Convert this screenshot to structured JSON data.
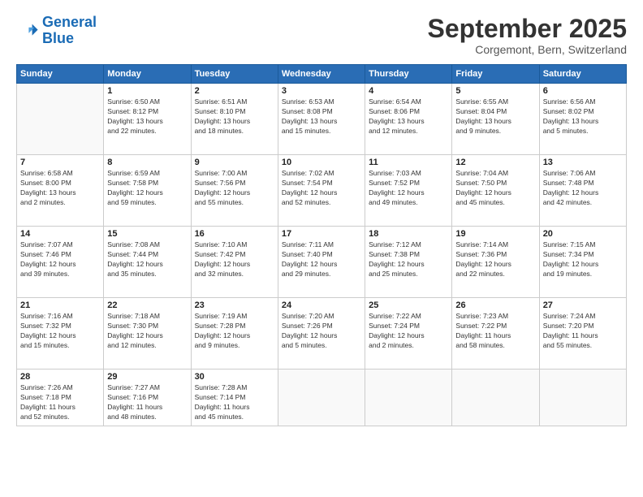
{
  "logo": {
    "line1": "General",
    "line2": "Blue"
  },
  "title": "September 2025",
  "subtitle": "Corgemont, Bern, Switzerland",
  "headers": [
    "Sunday",
    "Monday",
    "Tuesday",
    "Wednesday",
    "Thursday",
    "Friday",
    "Saturday"
  ],
  "weeks": [
    [
      {
        "day": "",
        "info": ""
      },
      {
        "day": "1",
        "info": "Sunrise: 6:50 AM\nSunset: 8:12 PM\nDaylight: 13 hours\nand 22 minutes."
      },
      {
        "day": "2",
        "info": "Sunrise: 6:51 AM\nSunset: 8:10 PM\nDaylight: 13 hours\nand 18 minutes."
      },
      {
        "day": "3",
        "info": "Sunrise: 6:53 AM\nSunset: 8:08 PM\nDaylight: 13 hours\nand 15 minutes."
      },
      {
        "day": "4",
        "info": "Sunrise: 6:54 AM\nSunset: 8:06 PM\nDaylight: 13 hours\nand 12 minutes."
      },
      {
        "day": "5",
        "info": "Sunrise: 6:55 AM\nSunset: 8:04 PM\nDaylight: 13 hours\nand 9 minutes."
      },
      {
        "day": "6",
        "info": "Sunrise: 6:56 AM\nSunset: 8:02 PM\nDaylight: 13 hours\nand 5 minutes."
      }
    ],
    [
      {
        "day": "7",
        "info": "Sunrise: 6:58 AM\nSunset: 8:00 PM\nDaylight: 13 hours\nand 2 minutes."
      },
      {
        "day": "8",
        "info": "Sunrise: 6:59 AM\nSunset: 7:58 PM\nDaylight: 12 hours\nand 59 minutes."
      },
      {
        "day": "9",
        "info": "Sunrise: 7:00 AM\nSunset: 7:56 PM\nDaylight: 12 hours\nand 55 minutes."
      },
      {
        "day": "10",
        "info": "Sunrise: 7:02 AM\nSunset: 7:54 PM\nDaylight: 12 hours\nand 52 minutes."
      },
      {
        "day": "11",
        "info": "Sunrise: 7:03 AM\nSunset: 7:52 PM\nDaylight: 12 hours\nand 49 minutes."
      },
      {
        "day": "12",
        "info": "Sunrise: 7:04 AM\nSunset: 7:50 PM\nDaylight: 12 hours\nand 45 minutes."
      },
      {
        "day": "13",
        "info": "Sunrise: 7:06 AM\nSunset: 7:48 PM\nDaylight: 12 hours\nand 42 minutes."
      }
    ],
    [
      {
        "day": "14",
        "info": "Sunrise: 7:07 AM\nSunset: 7:46 PM\nDaylight: 12 hours\nand 39 minutes."
      },
      {
        "day": "15",
        "info": "Sunrise: 7:08 AM\nSunset: 7:44 PM\nDaylight: 12 hours\nand 35 minutes."
      },
      {
        "day": "16",
        "info": "Sunrise: 7:10 AM\nSunset: 7:42 PM\nDaylight: 12 hours\nand 32 minutes."
      },
      {
        "day": "17",
        "info": "Sunrise: 7:11 AM\nSunset: 7:40 PM\nDaylight: 12 hours\nand 29 minutes."
      },
      {
        "day": "18",
        "info": "Sunrise: 7:12 AM\nSunset: 7:38 PM\nDaylight: 12 hours\nand 25 minutes."
      },
      {
        "day": "19",
        "info": "Sunrise: 7:14 AM\nSunset: 7:36 PM\nDaylight: 12 hours\nand 22 minutes."
      },
      {
        "day": "20",
        "info": "Sunrise: 7:15 AM\nSunset: 7:34 PM\nDaylight: 12 hours\nand 19 minutes."
      }
    ],
    [
      {
        "day": "21",
        "info": "Sunrise: 7:16 AM\nSunset: 7:32 PM\nDaylight: 12 hours\nand 15 minutes."
      },
      {
        "day": "22",
        "info": "Sunrise: 7:18 AM\nSunset: 7:30 PM\nDaylight: 12 hours\nand 12 minutes."
      },
      {
        "day": "23",
        "info": "Sunrise: 7:19 AM\nSunset: 7:28 PM\nDaylight: 12 hours\nand 9 minutes."
      },
      {
        "day": "24",
        "info": "Sunrise: 7:20 AM\nSunset: 7:26 PM\nDaylight: 12 hours\nand 5 minutes."
      },
      {
        "day": "25",
        "info": "Sunrise: 7:22 AM\nSunset: 7:24 PM\nDaylight: 12 hours\nand 2 minutes."
      },
      {
        "day": "26",
        "info": "Sunrise: 7:23 AM\nSunset: 7:22 PM\nDaylight: 11 hours\nand 58 minutes."
      },
      {
        "day": "27",
        "info": "Sunrise: 7:24 AM\nSunset: 7:20 PM\nDaylight: 11 hours\nand 55 minutes."
      }
    ],
    [
      {
        "day": "28",
        "info": "Sunrise: 7:26 AM\nSunset: 7:18 PM\nDaylight: 11 hours\nand 52 minutes."
      },
      {
        "day": "29",
        "info": "Sunrise: 7:27 AM\nSunset: 7:16 PM\nDaylight: 11 hours\nand 48 minutes."
      },
      {
        "day": "30",
        "info": "Sunrise: 7:28 AM\nSunset: 7:14 PM\nDaylight: 11 hours\nand 45 minutes."
      },
      {
        "day": "",
        "info": ""
      },
      {
        "day": "",
        "info": ""
      },
      {
        "day": "",
        "info": ""
      },
      {
        "day": "",
        "info": ""
      }
    ]
  ]
}
